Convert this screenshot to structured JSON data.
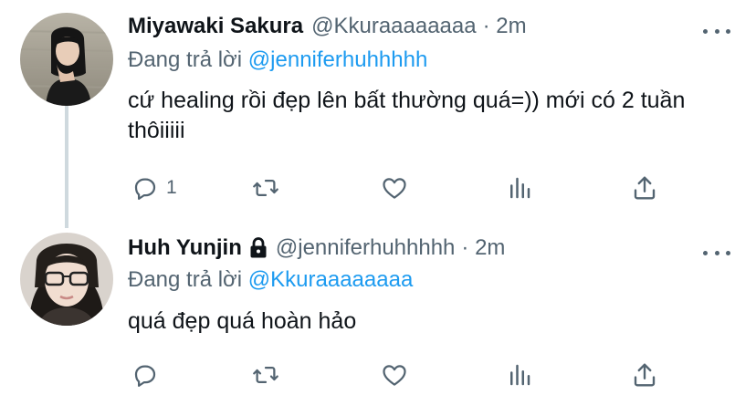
{
  "tweets": [
    {
      "name": "Miyawaki Sakura",
      "handle": "@Kkuraaaaaaaa",
      "time": "· 2m",
      "replying_label": "Đang trả lời",
      "replying_handle": "@jenniferhuhhhhh",
      "text": "cứ healing rồi đẹp lên bất thường quá=)) mới có 2 tuần thôiiiii",
      "reply_count": "1",
      "locked": false
    },
    {
      "name": "Huh Yunjin",
      "handle": "@jenniferhuhhhhh",
      "time": "· 2m",
      "replying_label": "Đang trả lời",
      "replying_handle": "@Kkuraaaaaaaa",
      "text": "quá đẹp quá hoàn hảo",
      "reply_count": "",
      "locked": true
    }
  ],
  "icons": [
    "more-icon",
    "lock-icon",
    "reply-icon",
    "retweet-icon",
    "like-icon",
    "stats-icon",
    "share-icon"
  ],
  "colors": {
    "link": "#1d9bf0",
    "secondary": "#536471",
    "text": "#0f1419",
    "thread_line": "#cfd9de"
  }
}
